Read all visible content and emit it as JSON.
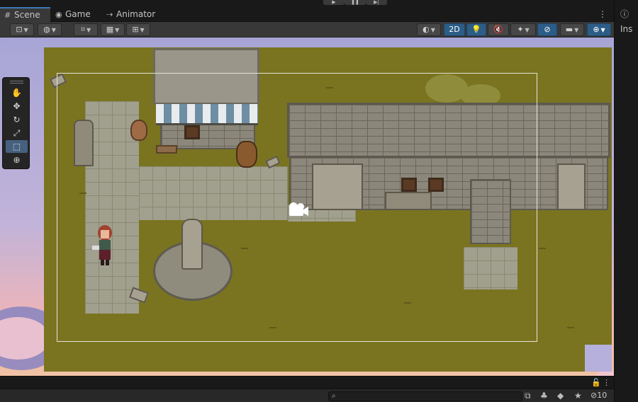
{
  "tabs": [
    {
      "label": "Scene",
      "icon": "grid-icon",
      "active": true
    },
    {
      "label": "Game",
      "icon": "gamepad-icon",
      "active": false
    },
    {
      "label": "Animator",
      "icon": "animator-icon",
      "active": false
    }
  ],
  "inspector_tab": {
    "label": "Ins",
    "icon": "info-icon"
  },
  "toolbar": {
    "toggle_2d_label": "2D"
  },
  "tools": [
    {
      "name": "hand-tool",
      "glyph": "✋"
    },
    {
      "name": "move-tool",
      "glyph": "✥"
    },
    {
      "name": "rotate-tool",
      "glyph": "↻"
    },
    {
      "name": "scale-tool",
      "glyph": "⤢"
    },
    {
      "name": "rect-tool",
      "glyph": "⬚",
      "active": true
    },
    {
      "name": "transform-tool",
      "glyph": "⊕"
    }
  ],
  "status": {
    "search_placeholder": "",
    "hidden_count": "10"
  },
  "colors": {
    "accent": "#3a79bb",
    "toggle_on": "#2c5d87",
    "ground": "#7a7420",
    "sky_top": "#a7a5d6"
  }
}
